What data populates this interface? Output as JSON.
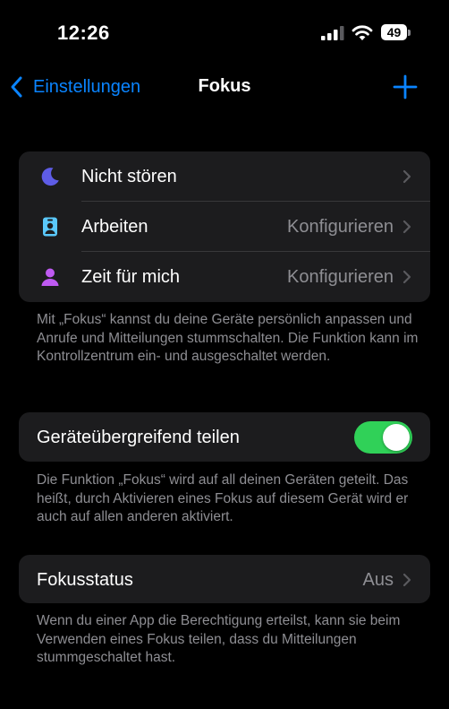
{
  "status_bar": {
    "time": "12:26",
    "battery_level": "49",
    "icons": [
      "signal-icon",
      "wifi-icon",
      "battery-icon"
    ]
  },
  "nav": {
    "back_label": "Einstellungen",
    "title": "Fokus",
    "add_icon": "plus-icon",
    "accent_color": "#0a84ff"
  },
  "focus_modes": [
    {
      "label": "Nicht stören",
      "value": "",
      "icon": "moon-icon",
      "icon_color": "#5e5ce6"
    },
    {
      "label": "Arbeiten",
      "value": "Konfigurieren",
      "icon": "work-badge-icon",
      "icon_color": "#5ac8fa"
    },
    {
      "label": "Zeit für mich",
      "value": "Konfigurieren",
      "icon": "person-icon",
      "icon_color": "#bf5af2"
    }
  ],
  "focus_modes_footer": "Mit „Fokus“ kannst du deine Geräte persönlich anpassen und Anrufe und Mitteilungen stummschalten. Die Funktion kann im Kontrollzentrum ein- und ausgeschaltet werden.",
  "share_across_devices": {
    "label": "Geräteübergreifend teilen",
    "enabled": true,
    "toggle_color": "#30d158",
    "footer": "Die Funktion „Fokus“ wird auf all deinen Geräten geteilt. Das heißt, durch Aktivieren eines Fokus auf diesem Gerät wird er auch auf allen anderen aktiviert."
  },
  "focus_status": {
    "label": "Fokusstatus",
    "value": "Aus",
    "footer": "Wenn du einer App die Berechtigung erteilst, kann sie beim Verwenden eines Fokus teilen, dass du Mitteilungen stummgeschaltet hast."
  }
}
